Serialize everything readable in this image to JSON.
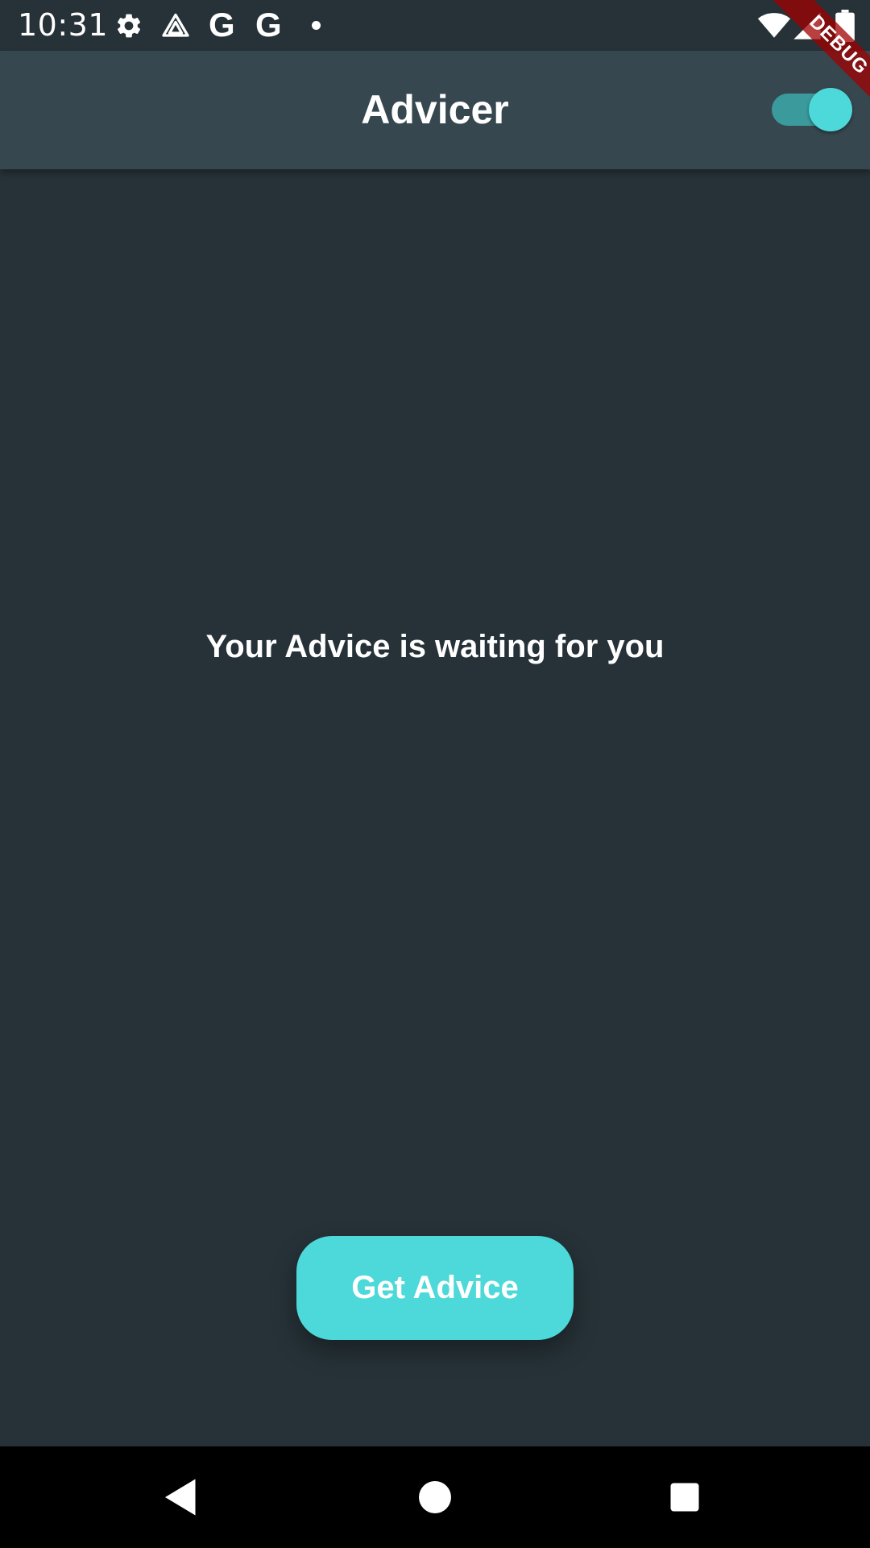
{
  "status_bar": {
    "time": "10:31",
    "left_icons": [
      "gear-icon",
      "drive-icon",
      "google-icon",
      "google-icon",
      "dot-icon"
    ],
    "google_letter": "G",
    "right_icons": [
      "wifi-icon",
      "signal-icon",
      "battery-icon"
    ]
  },
  "app_bar": {
    "title": "Advicer",
    "theme_toggle_on": true
  },
  "debug_banner": "DEBUG",
  "main": {
    "message": "Your Advice is waiting for you",
    "button_label": "Get Advice"
  },
  "nav_bar": {
    "buttons": [
      "back-icon",
      "home-icon",
      "recents-icon"
    ]
  },
  "colors": {
    "background": "#263238",
    "app_bar": "#37474f",
    "accent": "#4dd9d9",
    "debug_ribbon": "#a00000"
  }
}
